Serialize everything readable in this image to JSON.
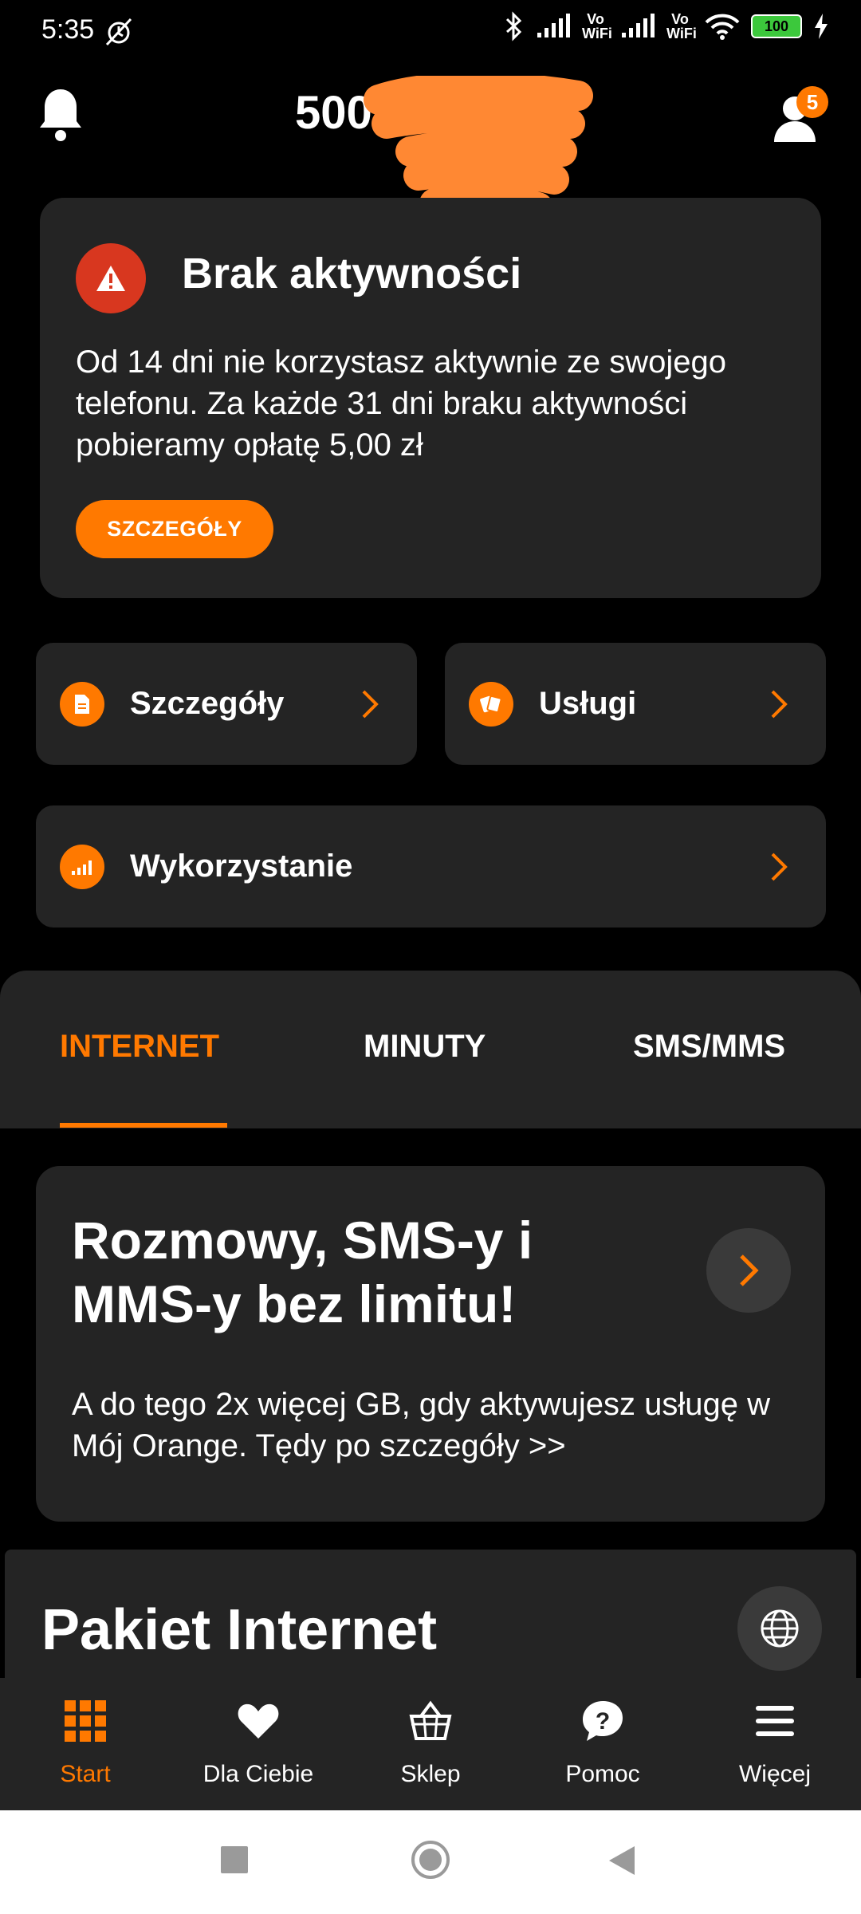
{
  "status_bar": {
    "time": "5:35",
    "vowifi_1": "Vo WiFi",
    "vowifi_2": "Vo WiFi",
    "battery": "100"
  },
  "header": {
    "phone_number": "500 6",
    "notifications_badge": "5"
  },
  "alert": {
    "title": "Brak aktywności",
    "body": "Od 14 dni nie korzystasz aktywnie ze swojego telefonu. Za każde 31 dni braku aktywności pobieramy opłatę 5,00 zł",
    "button_label": "SZCZEGÓŁY",
    "icon": "warning-icon"
  },
  "tiles": [
    {
      "label": "Szczegóły",
      "icon": "document-icon"
    },
    {
      "label": "Usługi",
      "icon": "services-icon"
    },
    {
      "label": "Wykorzystanie",
      "icon": "signal-bars-icon"
    }
  ],
  "tabs": [
    {
      "label": "INTERNET",
      "active": true
    },
    {
      "label": "MINUTY",
      "active": false
    },
    {
      "label": "SMS/MMS",
      "active": false
    }
  ],
  "promo": {
    "title": "Rozmowy, SMS-y i MMS-y bez limitu!",
    "body": "A do tego 2x więcej GB, gdy aktywujesz usługę w Mój Orange. Tędy po szczegóły >>"
  },
  "package": {
    "title": "Pakiet Internet"
  },
  "bottom_nav": [
    {
      "label": "Start",
      "icon": "grid-icon",
      "active": true
    },
    {
      "label": "Dla Ciebie",
      "icon": "heart-icon",
      "active": false
    },
    {
      "label": "Sklep",
      "icon": "basket-icon",
      "active": false
    },
    {
      "label": "Pomoc",
      "icon": "help-bubble-icon",
      "active": false
    },
    {
      "label": "Więcej",
      "icon": "menu-icon",
      "active": false
    }
  ],
  "colors": {
    "accent": "#ff7900",
    "card": "#242424",
    "background": "#000000",
    "alert_red": "#d8371f"
  }
}
